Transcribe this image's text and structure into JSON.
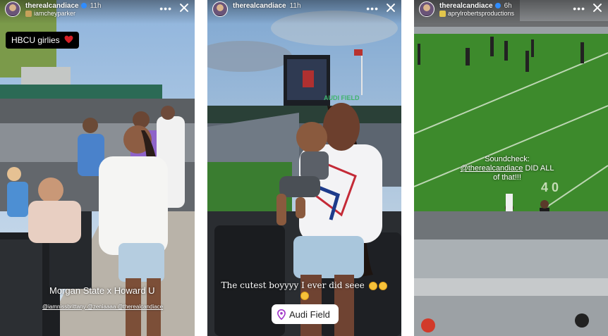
{
  "stories": [
    {
      "username": "therealcandiace",
      "time": "11h",
      "subline": "iamcheyparker",
      "sticker": "HBCU girlies",
      "caption": "Morgan State x Howard U",
      "mentions": "@iamnissbrittany @zeniaaaa @therealcandiace"
    },
    {
      "username": "therealcandiace",
      "time": "11h",
      "caption": "The cutest boyyyy I ever did seee",
      "location": "Audi Field",
      "venue_sign": "AUDI FIELD"
    },
    {
      "username": "therealcandiace",
      "time": "6h",
      "subline": "aprylrobertsproductions",
      "caption_prefix": "Soundcheck:",
      "caption_mention": "@therealcandiace",
      "caption_suffix": "DID ALL of that!!!",
      "yard_marker": "4 0"
    }
  ],
  "colors": {
    "accent_red": "#d61f26",
    "sticker_bg": "#000000",
    "verified_blue": "#2f8cff",
    "field_green": "#3d8a2c",
    "sky_blue": "#9fc3e6"
  },
  "icons": {
    "more": "more-horizontal-icon",
    "close": "close-icon",
    "heart": "heart-icon",
    "location_pin": "location-pin-icon"
  }
}
